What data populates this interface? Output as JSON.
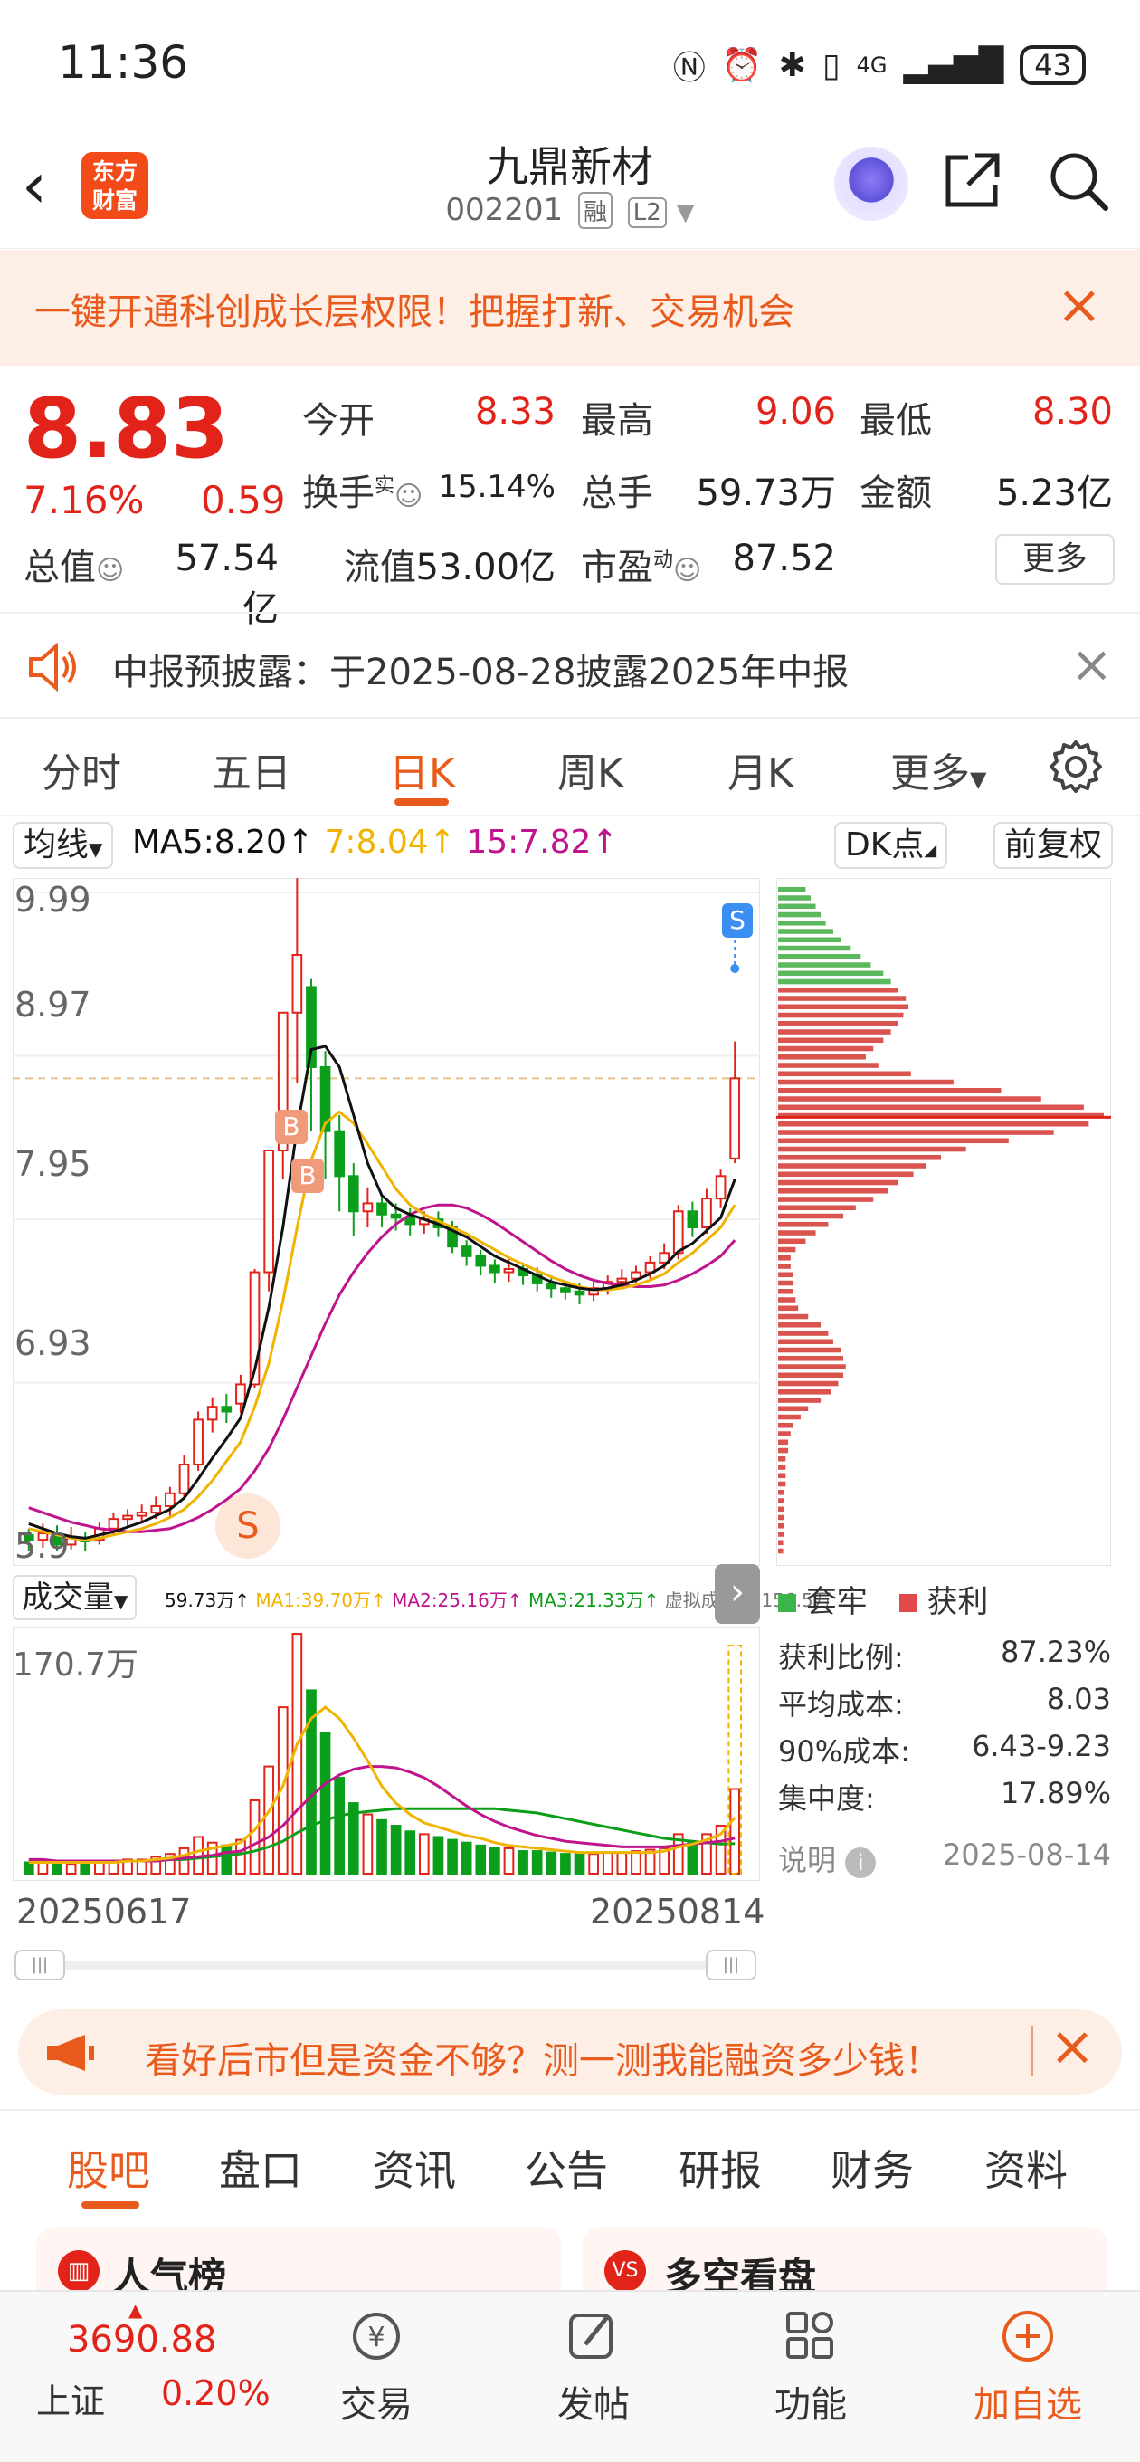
{
  "status_bar": {
    "time": "11:36",
    "battery": "43",
    "network": "4G"
  },
  "header": {
    "title": "九鼎新材",
    "code": "002201",
    "tag_margin": "融",
    "tag_level": "L2",
    "logo_text": "东方财富"
  },
  "banner": {
    "text": "一键开通科创成长层权限！把握打新、交易机会"
  },
  "quote": {
    "price": "8.83",
    "change_pct": "7.16%",
    "change": "0.59",
    "open_label": "今开",
    "open": "8.33",
    "high_label": "最高",
    "high": "9.06",
    "low_label": "最低",
    "low": "8.30",
    "turnover_label": "换手",
    "turnover_sup": "实",
    "turnover": "15.14%",
    "volume_label": "总手",
    "volume": "59.73万",
    "amount_label": "金额",
    "amount": "5.23亿",
    "mktcap_label": "总值",
    "mktcap": "57.54亿",
    "float_label": "流值",
    "float": "53.00亿",
    "pe_label": "市盈",
    "pe_sup": "动",
    "pe": "87.52",
    "more": "更多"
  },
  "notice": {
    "text": "中报预披露：于2025-08-28披露2025年中报"
  },
  "tabs": [
    {
      "label": "分时"
    },
    {
      "label": "五日"
    },
    {
      "label": "日K"
    },
    {
      "label": "周K"
    },
    {
      "label": "月K"
    },
    {
      "label": "更多"
    }
  ],
  "chart_header": {
    "ma_selector": "均线",
    "ma5": "MA5:8.20↑",
    "ma7": "7:8.04↑",
    "ma15": "15:7.82↑",
    "dk_button": "DK点",
    "adjust_button": "前复权"
  },
  "kline": {
    "y_labels": [
      "9.99",
      "8.97",
      "7.95",
      "6.93",
      "5.9"
    ],
    "markers": {
      "sell": "S",
      "buy": "B"
    }
  },
  "volume_header": {
    "selector": "成交量",
    "v_now": "59.73万↑",
    "ma1": "MA1:39.70万↑",
    "ma2": "MA2:25.16万↑",
    "ma3": "MA3:21.33万↑",
    "virtual": "虚拟成交量:156.5万"
  },
  "volume_axis": {
    "max_label": "170.7万"
  },
  "dates": {
    "start": "20250617",
    "end": "20250814"
  },
  "chip_distribution": {
    "legend_trapped": "套牢",
    "legend_profit": "获利",
    "rows": [
      {
        "label": "获利比例:",
        "value": "87.23%"
      },
      {
        "label": "平均成本:",
        "value": "8.03"
      },
      {
        "label": "90%成本:",
        "value": "6.43-9.23"
      },
      {
        "label": "集中度:",
        "value": "17.89%"
      }
    ],
    "note_label": "说明",
    "note_date": "2025-08-14"
  },
  "ad": {
    "text": "看好后市但是资金不够？测一测我能融资多少钱！"
  },
  "bottom_tabs": [
    {
      "label": "股吧"
    },
    {
      "label": "盘口"
    },
    {
      "label": "资讯"
    },
    {
      "label": "公告"
    },
    {
      "label": "研报"
    },
    {
      "label": "财务"
    },
    {
      "label": "资料"
    }
  ],
  "cards": {
    "left": "人气榜",
    "right": "多空看盘"
  },
  "index": {
    "value": "3690.88",
    "name": "上证",
    "pct": "0.20%"
  },
  "nav": [
    {
      "label": "交易"
    },
    {
      "label": "发帖"
    },
    {
      "label": "功能"
    },
    {
      "label": "加自选"
    }
  ],
  "colors": {
    "up": "#e2231a",
    "down": "#0a9e1b",
    "accent": "#e85b1c",
    "ma5": "#111111",
    "ma7": "#f0b400",
    "ma15": "#c0148c"
  },
  "chart_data": {
    "type": "candlestick",
    "y_range": [
      5.9,
      9.99
    ],
    "candles": [
      [
        5.98,
        5.95,
        6.02,
        5.88
      ],
      [
        5.95,
        5.99,
        6.05,
        5.9
      ],
      [
        5.99,
        5.92,
        6.04,
        5.88
      ],
      [
        5.92,
        5.96,
        6.03,
        5.89
      ],
      [
        5.96,
        5.94,
        6.0,
        5.88
      ],
      [
        5.95,
        6.02,
        6.06,
        5.92
      ],
      [
        6.02,
        6.08,
        6.12,
        5.98
      ],
      [
        6.08,
        6.1,
        6.14,
        6.03
      ],
      [
        6.1,
        6.12,
        6.17,
        6.06
      ],
      [
        6.12,
        6.16,
        6.22,
        6.08
      ],
      [
        6.16,
        6.24,
        6.28,
        6.1
      ],
      [
        6.24,
        6.42,
        6.48,
        6.2
      ],
      [
        6.42,
        6.7,
        6.75,
        6.38
      ],
      [
        6.7,
        6.78,
        6.84,
        6.62
      ],
      [
        6.78,
        6.75,
        6.86,
        6.68
      ],
      [
        6.8,
        6.92,
        6.98,
        6.74
      ],
      [
        6.92,
        7.62,
        7.64,
        6.9
      ],
      [
        7.62,
        8.38,
        8.38,
        7.5
      ],
      [
        8.38,
        9.24,
        9.24,
        8.2
      ],
      [
        9.24,
        9.6,
        10.08,
        8.8
      ],
      [
        9.4,
        8.9,
        9.45,
        8.5
      ],
      [
        8.9,
        8.5,
        9.0,
        8.2
      ],
      [
        8.5,
        8.22,
        8.6,
        8.0
      ],
      [
        8.22,
        8.0,
        8.3,
        7.85
      ],
      [
        8.0,
        8.05,
        8.15,
        7.9
      ],
      [
        8.05,
        7.98,
        8.1,
        7.9
      ],
      [
        7.98,
        7.96,
        8.05,
        7.88
      ],
      [
        7.96,
        7.92,
        8.02,
        7.85
      ],
      [
        7.92,
        7.95,
        8.0,
        7.86
      ],
      [
        7.95,
        7.9,
        8.0,
        7.84
      ],
      [
        7.9,
        7.78,
        7.94,
        7.74
      ],
      [
        7.78,
        7.72,
        7.82,
        7.66
      ],
      [
        7.72,
        7.66,
        7.76,
        7.6
      ],
      [
        7.66,
        7.62,
        7.7,
        7.55
      ],
      [
        7.62,
        7.64,
        7.7,
        7.56
      ],
      [
        7.64,
        7.6,
        7.68,
        7.54
      ],
      [
        7.6,
        7.55,
        7.65,
        7.5
      ],
      [
        7.55,
        7.52,
        7.6,
        7.46
      ],
      [
        7.52,
        7.5,
        7.56,
        7.45
      ],
      [
        7.5,
        7.48,
        7.55,
        7.42
      ],
      [
        7.48,
        7.52,
        7.56,
        7.44
      ],
      [
        7.52,
        7.56,
        7.6,
        7.48
      ],
      [
        7.56,
        7.58,
        7.64,
        7.52
      ],
      [
        7.58,
        7.62,
        7.66,
        7.55
      ],
      [
        7.62,
        7.68,
        7.72,
        7.58
      ],
      [
        7.68,
        7.74,
        7.8,
        7.64
      ],
      [
        7.74,
        8.0,
        8.04,
        7.7
      ],
      [
        8.0,
        7.9,
        8.06,
        7.84
      ],
      [
        7.9,
        8.08,
        8.14,
        7.86
      ],
      [
        8.08,
        8.22,
        8.26,
        8.02
      ],
      [
        8.33,
        8.83,
        9.06,
        8.3
      ]
    ],
    "ma5": [
      6.05,
      6.02,
      5.99,
      5.97,
      5.96,
      5.98,
      6.0,
      6.03,
      6.06,
      6.1,
      6.14,
      6.21,
      6.33,
      6.46,
      6.58,
      6.71,
      7.01,
      7.4,
      7.9,
      8.52,
      9.01,
      9.03,
      8.9,
      8.6,
      8.3,
      8.1,
      8.02,
      7.98,
      7.95,
      7.92,
      7.88,
      7.84,
      7.78,
      7.72,
      7.68,
      7.64,
      7.6,
      7.56,
      7.54,
      7.52,
      7.51,
      7.52,
      7.54,
      7.57,
      7.61,
      7.66,
      7.75,
      7.8,
      7.88,
      7.96,
      8.2
    ],
    "ma7": [
      6.02,
      6.0,
      5.98,
      5.96,
      5.95,
      5.96,
      5.98,
      6.0,
      6.02,
      6.05,
      6.09,
      6.14,
      6.22,
      6.32,
      6.44,
      6.56,
      6.78,
      7.05,
      7.44,
      7.9,
      8.32,
      8.55,
      8.62,
      8.55,
      8.42,
      8.28,
      8.14,
      8.04,
      7.98,
      7.94,
      7.9,
      7.86,
      7.81,
      7.76,
      7.71,
      7.67,
      7.63,
      7.59,
      7.56,
      7.53,
      7.51,
      7.51,
      7.52,
      7.54,
      7.57,
      7.61,
      7.68,
      7.74,
      7.82,
      7.9,
      8.04
    ],
    "ma15": [
      6.15,
      6.12,
      6.09,
      6.06,
      6.04,
      6.02,
      6.01,
      6.0,
      6.0,
      6.01,
      6.02,
      6.05,
      6.09,
      6.14,
      6.2,
      6.27,
      6.38,
      6.52,
      6.7,
      6.9,
      7.1,
      7.3,
      7.48,
      7.62,
      7.74,
      7.84,
      7.92,
      7.98,
      8.02,
      8.04,
      8.04,
      8.02,
      7.98,
      7.93,
      7.87,
      7.81,
      7.75,
      7.69,
      7.64,
      7.6,
      7.57,
      7.55,
      7.54,
      7.53,
      7.53,
      7.54,
      7.57,
      7.61,
      7.66,
      7.72,
      7.82
    ],
    "volume_max": 170.7,
    "volumes": [
      8,
      9,
      8,
      7,
      7,
      8,
      9,
      10,
      10,
      12,
      14,
      18,
      26,
      22,
      20,
      24,
      52,
      76,
      118,
      170,
      130,
      100,
      68,
      50,
      42,
      38,
      34,
      30,
      28,
      26,
      24,
      22,
      20,
      18,
      18,
      16,
      16,
      15,
      14,
      14,
      14,
      15,
      15,
      16,
      17,
      18,
      28,
      22,
      28,
      34,
      60
    ],
    "vol_ma1": [
      8,
      8,
      8,
      8,
      8,
      8,
      8,
      9,
      9,
      10,
      11,
      13,
      16,
      18,
      20,
      22,
      31,
      44,
      62,
      92,
      110,
      118,
      110,
      96,
      80,
      62,
      50,
      42,
      36,
      33,
      30,
      27,
      25,
      22,
      20,
      19,
      18,
      17,
      16,
      15,
      15,
      15,
      15,
      15,
      15,
      16,
      19,
      21,
      24,
      28,
      39.7
    ],
    "vol_ma2": [
      10,
      10,
      9,
      9,
      9,
      9,
      9,
      9,
      9,
      9,
      10,
      11,
      12,
      13,
      15,
      16,
      21,
      26,
      34,
      45,
      55,
      64,
      70,
      74,
      76,
      76,
      75,
      72,
      68,
      62,
      55,
      48,
      42,
      37,
      33,
      30,
      27,
      25,
      23,
      22,
      21,
      20,
      19,
      19,
      19,
      19,
      20,
      21,
      22,
      23,
      25.16
    ],
    "vol_ma3": [
      9,
      9,
      9,
      9,
      9,
      9,
      9,
      9,
      9,
      9,
      10,
      10,
      11,
      12,
      13,
      14,
      16,
      19,
      23,
      29,
      34,
      38,
      41,
      43,
      44,
      45,
      46,
      46,
      46,
      46,
      46,
      46,
      46,
      46,
      45,
      44,
      43,
      41,
      39,
      37,
      35,
      33,
      31,
      29,
      27,
      25,
      24,
      23,
      22,
      21,
      21.33
    ],
    "chip_bins": {
      "price_from": 9.99,
      "price_to": 5.9,
      "trapped": [
        22,
        26,
        30,
        34,
        38,
        44,
        50,
        58,
        66,
        74,
        84,
        90,
        0,
        0,
        0,
        0,
        0,
        0,
        0,
        0,
        0,
        0,
        0,
        0,
        0,
        0,
        0,
        0,
        0,
        0,
        0,
        0,
        0,
        0,
        0,
        0,
        0,
        0,
        0,
        0,
        0,
        0,
        0,
        0,
        0,
        0,
        0,
        0,
        0,
        0,
        0,
        0,
        0,
        0,
        0,
        0,
        0,
        0,
        0,
        0,
        0,
        0,
        0,
        0,
        0,
        0,
        0,
        0,
        0,
        0,
        0,
        0,
        0,
        0,
        0,
        0,
        0,
        0,
        0,
        0
      ],
      "profit": [
        0,
        0,
        0,
        0,
        0,
        0,
        0,
        0,
        0,
        0,
        0,
        0,
        96,
        102,
        104,
        100,
        96,
        90,
        84,
        76,
        70,
        80,
        106,
        140,
        178,
        210,
        244,
        260,
        248,
        220,
        184,
        150,
        130,
        118,
        108,
        96,
        88,
        76,
        62,
        52,
        40,
        30,
        22,
        14,
        10,
        10,
        12,
        12,
        12,
        14,
        16,
        24,
        34,
        40,
        44,
        50,
        52,
        54,
        52,
        48,
        42,
        34,
        24,
        18,
        12,
        10,
        8,
        8,
        6,
        6,
        6,
        6,
        5,
        5,
        5,
        5,
        5,
        5,
        4,
        4
      ]
    }
  }
}
